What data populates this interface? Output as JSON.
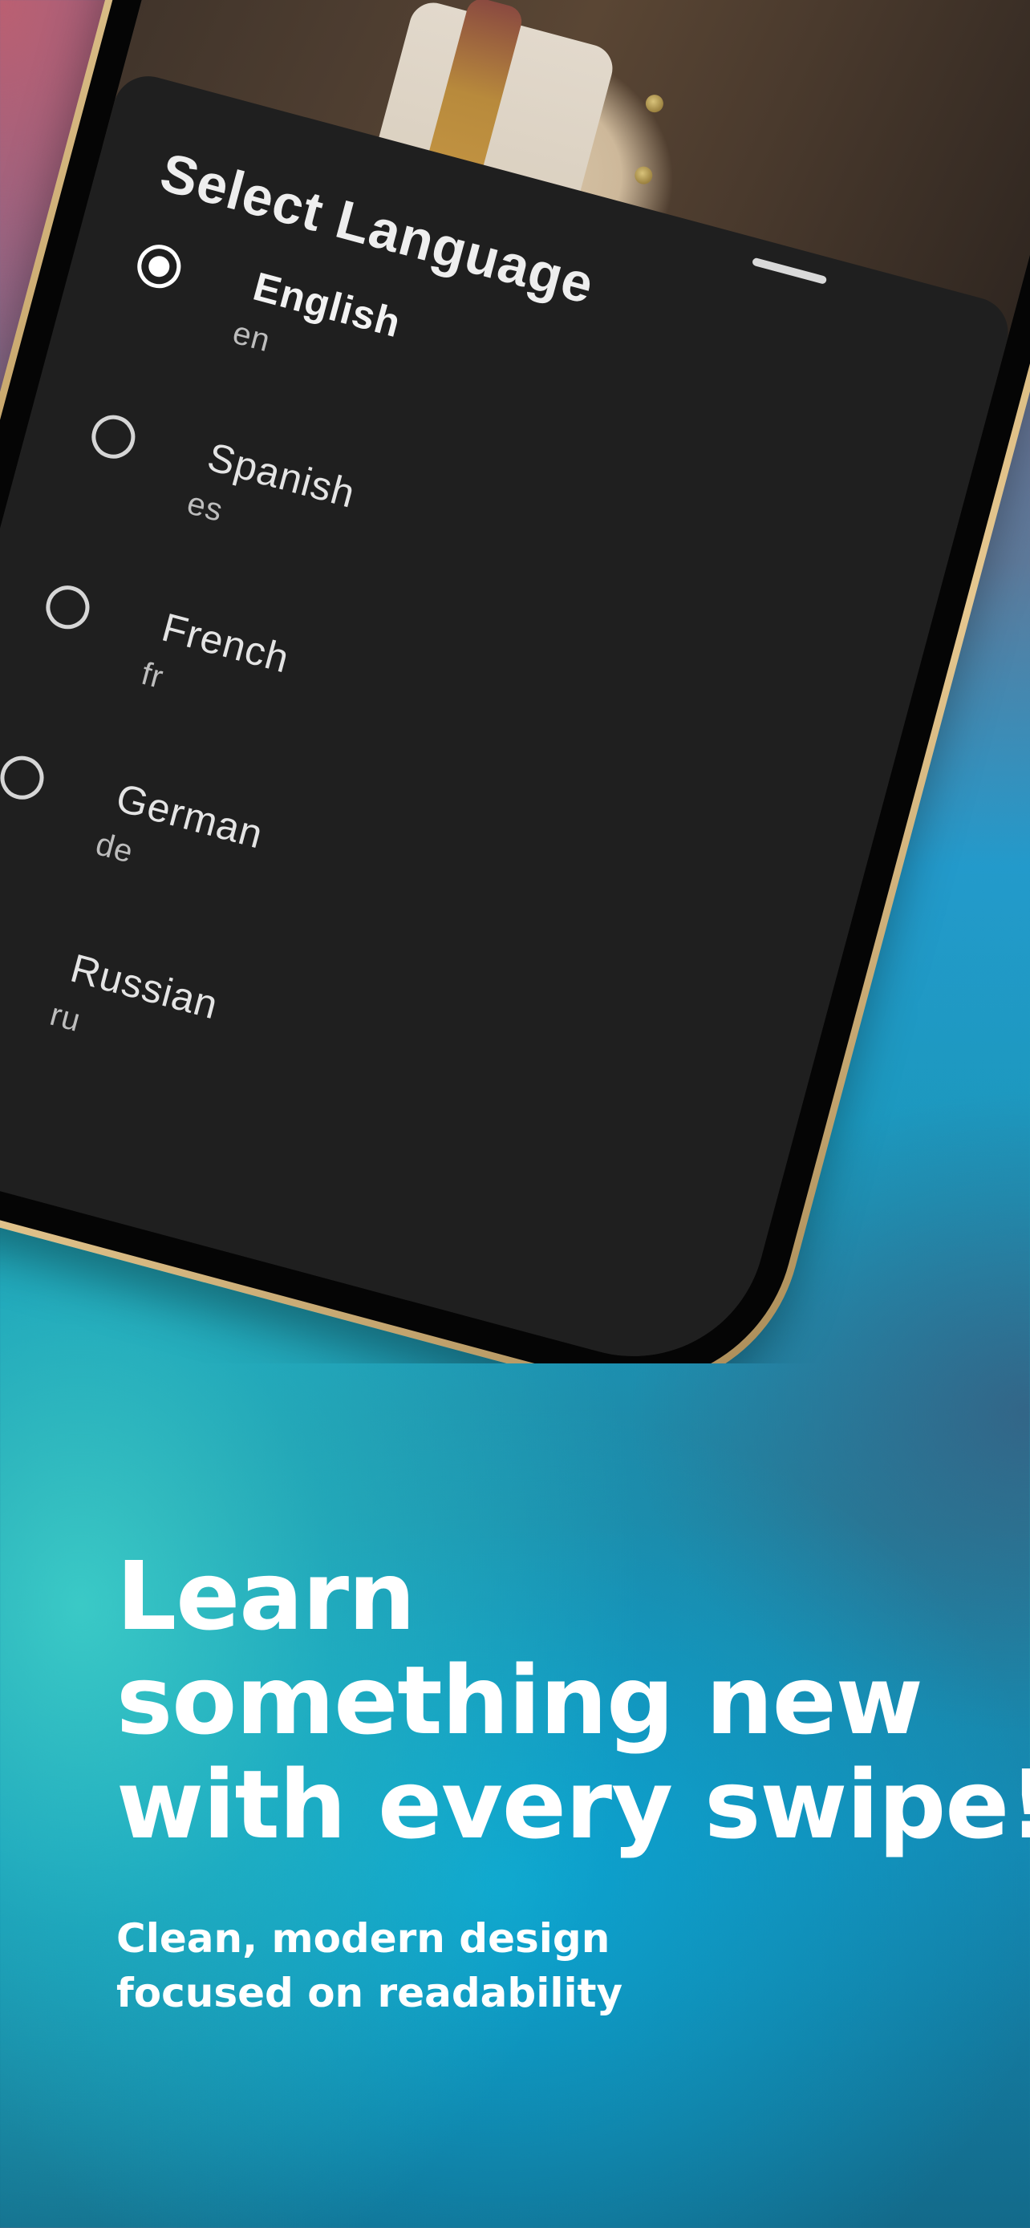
{
  "language_sheet": {
    "title": "Select Language",
    "languages": [
      {
        "name": "English",
        "code": "en",
        "selected": true
      },
      {
        "name": "Spanish",
        "code": "es",
        "selected": false
      },
      {
        "name": "French",
        "code": "fr",
        "selected": false
      },
      {
        "name": "German",
        "code": "de",
        "selected": false
      },
      {
        "name": "Russian",
        "code": "ru",
        "selected": false
      }
    ]
  },
  "headline": {
    "line1": "Learn",
    "line2": "something new",
    "line3": "with every swipe!"
  },
  "subheadline": {
    "line1": "Clean, modern design",
    "line2": "focused on readability"
  },
  "colors": {
    "sheet_background": "#1f1f1f",
    "phone_frame": "#d8b982",
    "text_primary": "#ffffff",
    "background_top": "#b8606f",
    "background_middle": "#239acb",
    "background_glow": "#3ccdc8",
    "background_bottom": "#136a8a"
  }
}
